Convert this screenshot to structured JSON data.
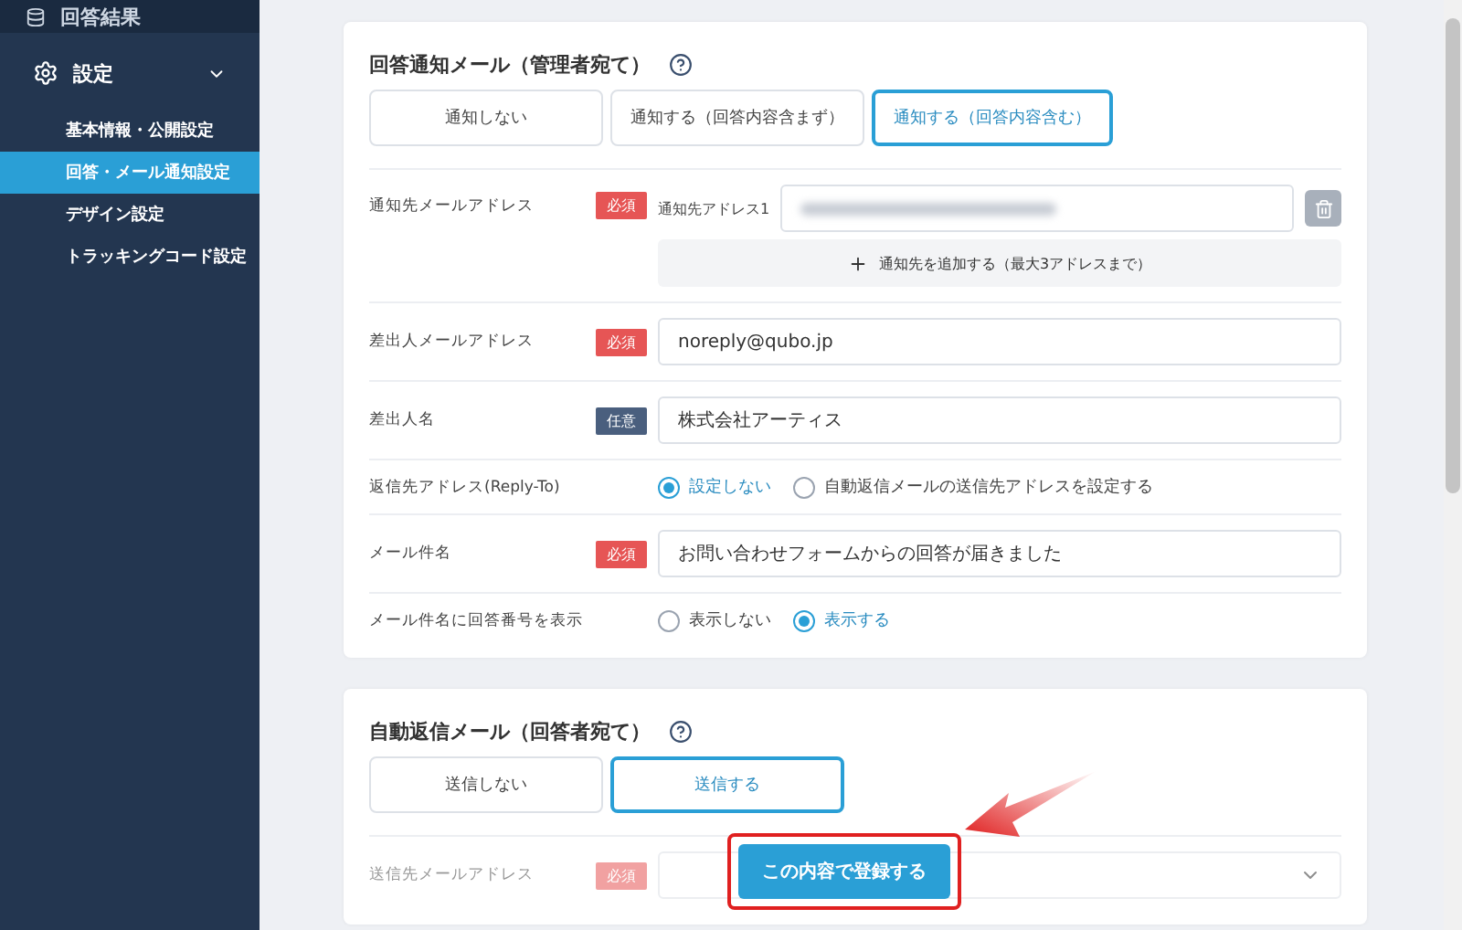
{
  "sidebar": {
    "top_item": {
      "label": "回答結果"
    },
    "section": {
      "label": "設定",
      "expanded": true,
      "children": [
        {
          "label": "基本情報・公開設定",
          "selected": false
        },
        {
          "label": "回答・メール通知設定",
          "selected": true
        },
        {
          "label": "デザイン設定",
          "selected": false
        },
        {
          "label": "トラッキングコード設定",
          "selected": false
        }
      ]
    }
  },
  "admin_mail": {
    "title": "回答通知メール（管理者宛て）",
    "options": [
      {
        "label": "通知しない",
        "selected": false
      },
      {
        "label": "通知する（回答内容含まず）",
        "selected": false
      },
      {
        "label": "通知する（回答内容含む）",
        "selected": true
      }
    ],
    "rows": [
      {
        "kind": "addresses",
        "label": "通知先メールアドレス",
        "badge": {
          "label": "必須",
          "required": true
        },
        "addresses": [
          {
            "label": "通知先アドレス1"
          }
        ],
        "add_button": "通知先を追加する（最大3アドレスまで）"
      },
      {
        "kind": "text",
        "label": "差出人メールアドレス",
        "badge": {
          "label": "必須",
          "required": true
        },
        "value": "noreply@qubo.jp"
      },
      {
        "kind": "text",
        "label": "差出人名",
        "badge": {
          "label": "任意",
          "required": false
        },
        "value": "株式会社アーティス"
      },
      {
        "kind": "radio",
        "label": "返信先アドレス(Reply-To)",
        "options": [
          {
            "label": "設定しない",
            "selected": true
          },
          {
            "label": "自動返信メールの送信先アドレスを設定する",
            "selected": false
          }
        ]
      },
      {
        "kind": "text",
        "label": "メール件名",
        "badge": {
          "label": "必須",
          "required": true
        },
        "value": "お問い合わせフォームからの回答が届きました"
      },
      {
        "kind": "radio",
        "label": "メール件名に回答番号を表示",
        "options": [
          {
            "label": "表示しない",
            "selected": false
          },
          {
            "label": "表示する",
            "selected": true
          }
        ]
      }
    ]
  },
  "auto_reply": {
    "title": "自動返信メール（回答者宛て）",
    "options": [
      {
        "label": "送信しない",
        "selected": false
      },
      {
        "label": "送信する",
        "selected": true
      }
    ],
    "rows": [
      {
        "kind": "select",
        "label": "送信先メールアドレス",
        "badge": {
          "label": "必須",
          "required": true
        }
      }
    ]
  },
  "save_button": {
    "label": "この内容で登録する"
  }
}
